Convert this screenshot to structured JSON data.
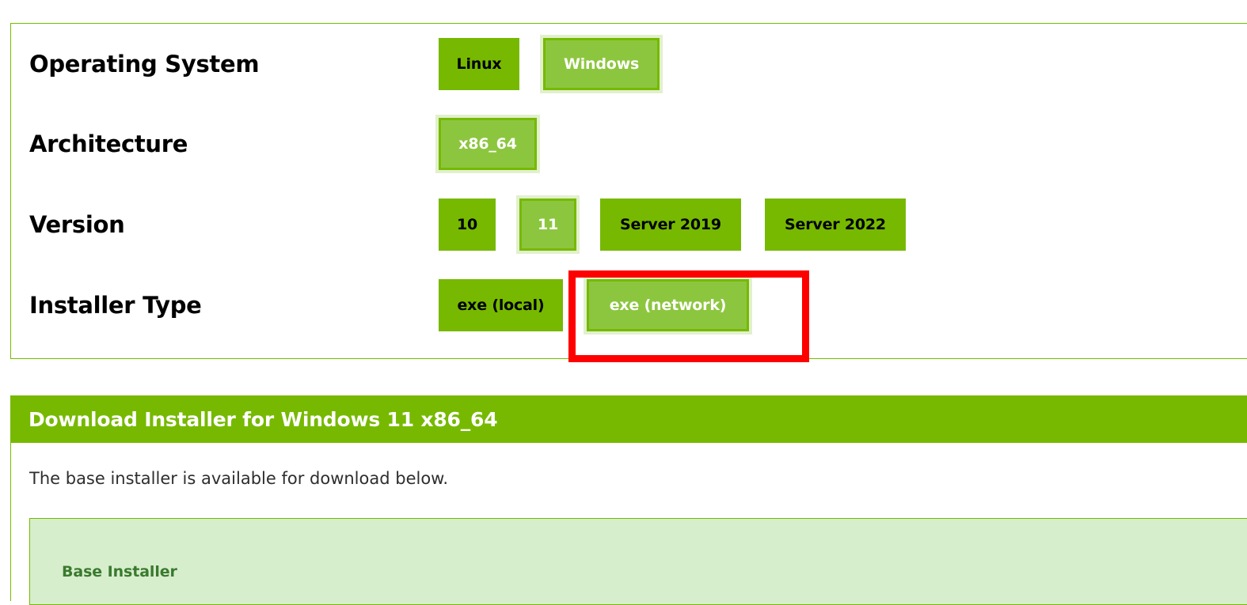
{
  "selector": {
    "rows": [
      {
        "id": "operating-system",
        "label": "Operating System",
        "options": [
          {
            "label": "Linux",
            "selected": false
          },
          {
            "label": "Windows",
            "selected": true
          }
        ]
      },
      {
        "id": "architecture",
        "label": "Architecture",
        "options": [
          {
            "label": "x86_64",
            "selected": true
          }
        ]
      },
      {
        "id": "version",
        "label": "Version",
        "options": [
          {
            "label": "10",
            "selected": false
          },
          {
            "label": "11",
            "selected": true
          },
          {
            "label": "Server 2019",
            "selected": false
          },
          {
            "label": "Server 2022",
            "selected": false
          }
        ]
      },
      {
        "id": "installer-type",
        "label": "Installer Type",
        "options": [
          {
            "label": "exe (local)",
            "selected": false
          },
          {
            "label": "exe (network)",
            "selected": true
          }
        ]
      }
    ]
  },
  "annotation": {
    "target": "exe (network)",
    "color": "#ff0000",
    "shape": "rectangle"
  },
  "download": {
    "header_title": "Download Installer for Windows 11 x86_64",
    "note": "The base installer is available for download below.",
    "base_installer_title": "Base Installer"
  },
  "colors": {
    "brand_green": "#76b900",
    "selected_green": "#8cc63f",
    "selected_halo": "#e2f0cd",
    "panel_light_green": "#d7eecd",
    "base_installer_text": "#3a7a2e",
    "annotation_red": "#ff0000"
  }
}
